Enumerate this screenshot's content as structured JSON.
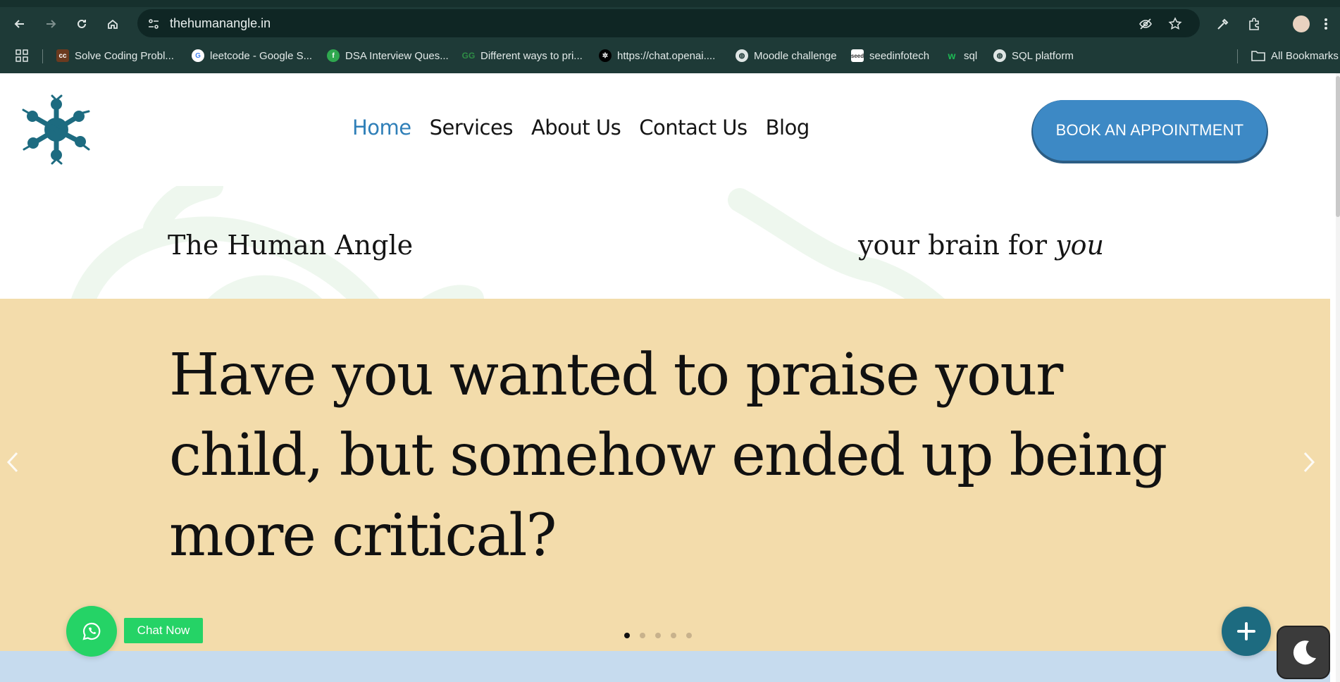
{
  "browser": {
    "url": "thehumanangle.in",
    "bookmarks": [
      {
        "label": "Solve Coding Probl...",
        "icon": "cc-icon"
      },
      {
        "label": "leetcode - Google S...",
        "icon": "google-icon"
      },
      {
        "label": "DSA Interview Ques...",
        "icon": "leaf-icon"
      },
      {
        "label": "Different ways to pri...",
        "icon": "gfg-icon"
      },
      {
        "label": "https://chat.openai....",
        "icon": "openai-icon"
      },
      {
        "label": "Moodle challenge",
        "icon": "globe-icon"
      },
      {
        "label": "seedinfotech",
        "icon": "seed-icon"
      },
      {
        "label": "sql",
        "icon": "w-icon"
      },
      {
        "label": "SQL platform",
        "icon": "globe-icon"
      }
    ],
    "all_bookmarks_label": "All Bookmarks"
  },
  "header": {
    "nav": [
      {
        "label": "Home",
        "active": true
      },
      {
        "label": "Services",
        "active": false
      },
      {
        "label": "About Us",
        "active": false
      },
      {
        "label": "Contact Us",
        "active": false
      },
      {
        "label": "Blog",
        "active": false
      }
    ],
    "cta_label": "BOOK AN APPOINTMENT"
  },
  "brand": {
    "left": "The Human Angle",
    "right_prefix": "your brain for",
    "right_emphasis": "you"
  },
  "hero": {
    "headline": "Have you wanted to praise your child, but somehow ended up being more critical?",
    "slide_count": 5,
    "active_slide": 1
  },
  "widgets": {
    "chat_label": "Chat Now"
  },
  "colors": {
    "accent": "#3d89c5",
    "nav_active": "#2f7fb8",
    "hero_bg": "#f3dcab",
    "whatsapp": "#25d366",
    "logo": "#1d6b80"
  }
}
